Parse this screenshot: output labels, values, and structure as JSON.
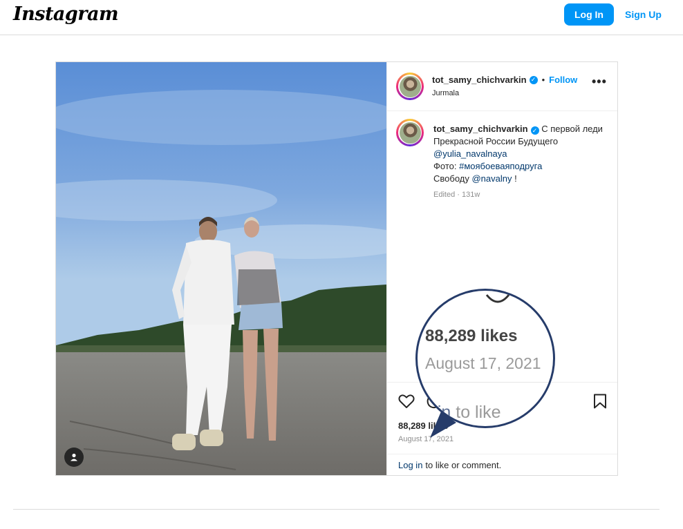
{
  "header": {
    "logo_text": "Instagram",
    "login_label": "Log In",
    "signup_label": "Sign Up"
  },
  "post": {
    "username": "tot_samy_chichvarkin",
    "follow_label": "Follow",
    "location": "Jurmala",
    "caption": {
      "text_1": "С первой леди Прекрасной России Будущего",
      "mention_1": "@yulia_navalnaya",
      "photo_label": "Фото:",
      "hashtag": "#моябоеваяподруга",
      "freedom_label": "Свободу",
      "mention_2": "@navalny",
      "end": " !"
    },
    "edited": "Edited · 131w",
    "likes": "88,289 likes",
    "date": "August 17, 2021",
    "comment_login": "Log in",
    "comment_rest": "to like or comment."
  },
  "zoom": {
    "likes": "88,289 likes",
    "date": "August 17, 2021",
    "login_partial": "g in",
    "rest_partial": " to like"
  },
  "colors": {
    "accent": "#0095f6",
    "link": "#00376b",
    "zoom_border": "#263c6a"
  },
  "icons": [
    "heart-icon",
    "comment-icon",
    "bookmark-icon",
    "more-icon",
    "verified-icon",
    "user-tag-icon"
  ]
}
